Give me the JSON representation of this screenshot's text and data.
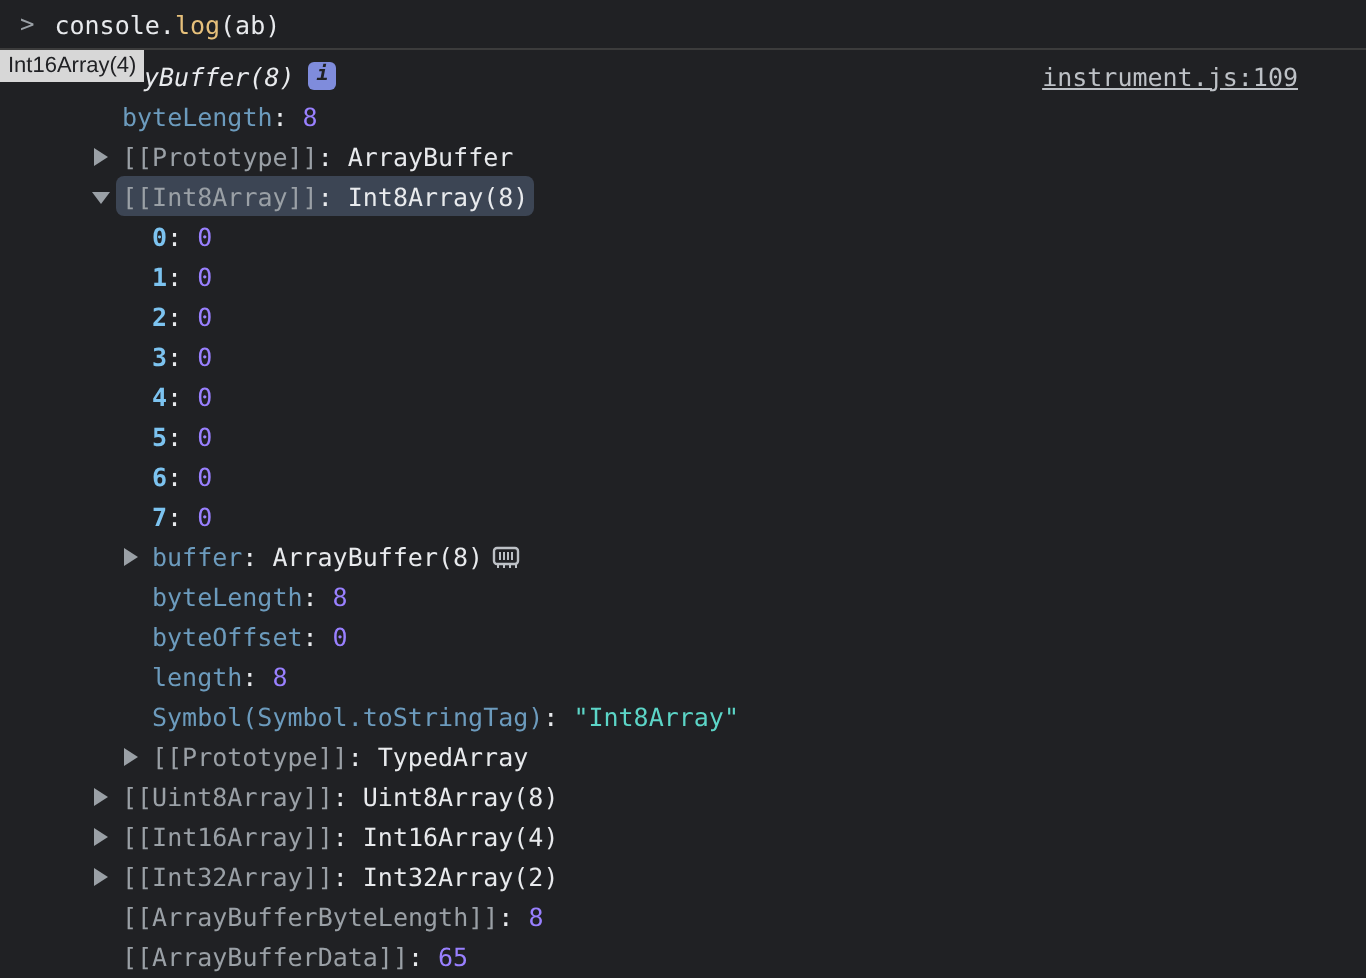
{
  "input": {
    "prompt": ">",
    "code_parts": [
      {
        "text": "console.",
        "kind": "plain"
      },
      {
        "text": "log",
        "kind": "function"
      },
      {
        "text": "(ab)",
        "kind": "plain"
      }
    ]
  },
  "tooltip": "Int16Array(4)",
  "header": {
    "text": "yBuffer(8)",
    "badge": "i",
    "source": "instrument.js:109"
  },
  "tree": [
    {
      "key": {
        "text": "byteLength",
        "kind": "prop"
      },
      "sep": ":",
      "value": {
        "text": "8",
        "kind": "number"
      },
      "selected": false
    },
    {
      "key": {
        "text": "[[Prototype]]",
        "kind": "internal"
      },
      "sep": ":",
      "value": {
        "text": "ArrayBuffer",
        "kind": "object"
      },
      "expanded": false,
      "selected": false
    },
    {
      "key": {
        "text": "[[Int8Array]]",
        "kind": "internal"
      },
      "sep": ":",
      "value": {
        "text": "Int8Array(8)",
        "kind": "object"
      },
      "expanded": true,
      "selected": true,
      "children": [
        {
          "key": {
            "text": "0",
            "kind": "index"
          },
          "sep": ":",
          "value": {
            "text": "0",
            "kind": "number"
          },
          "selected": false
        },
        {
          "key": {
            "text": "1",
            "kind": "index"
          },
          "sep": ":",
          "value": {
            "text": "0",
            "kind": "number"
          },
          "selected": false
        },
        {
          "key": {
            "text": "2",
            "kind": "index"
          },
          "sep": ":",
          "value": {
            "text": "0",
            "kind": "number"
          },
          "selected": false
        },
        {
          "key": {
            "text": "3",
            "kind": "index"
          },
          "sep": ":",
          "value": {
            "text": "0",
            "kind": "number"
          },
          "selected": false
        },
        {
          "key": {
            "text": "4",
            "kind": "index"
          },
          "sep": ":",
          "value": {
            "text": "0",
            "kind": "number"
          },
          "selected": false
        },
        {
          "key": {
            "text": "5",
            "kind": "index"
          },
          "sep": ":",
          "value": {
            "text": "0",
            "kind": "number"
          },
          "selected": false
        },
        {
          "key": {
            "text": "6",
            "kind": "index"
          },
          "sep": ":",
          "value": {
            "text": "0",
            "kind": "number"
          },
          "selected": false
        },
        {
          "key": {
            "text": "7",
            "kind": "index"
          },
          "sep": ":",
          "value": {
            "text": "0",
            "kind": "number"
          },
          "selected": false
        },
        {
          "key": {
            "text": "buffer",
            "kind": "prop"
          },
          "sep": ":",
          "value": {
            "text": "ArrayBuffer(8)",
            "kind": "object"
          },
          "expanded": false,
          "memory_button": true,
          "selected": false
        },
        {
          "key": {
            "text": "byteLength",
            "kind": "prop"
          },
          "sep": ":",
          "value": {
            "text": "8",
            "kind": "number"
          },
          "selected": false
        },
        {
          "key": {
            "text": "byteOffset",
            "kind": "prop"
          },
          "sep": ":",
          "value": {
            "text": "0",
            "kind": "number"
          },
          "selected": false
        },
        {
          "key": {
            "text": "length",
            "kind": "prop"
          },
          "sep": ":",
          "value": {
            "text": "8",
            "kind": "number"
          },
          "selected": false
        },
        {
          "key": {
            "text": "Symbol(Symbol.toStringTag)",
            "kind": "prop"
          },
          "sep": ":",
          "value": {
            "text": "\"Int8Array\"",
            "kind": "string"
          },
          "selected": false
        },
        {
          "key": {
            "text": "[[Prototype]]",
            "kind": "internal"
          },
          "sep": ":",
          "value": {
            "text": "TypedArray",
            "kind": "object"
          },
          "expanded": false,
          "selected": false
        }
      ]
    },
    {
      "key": {
        "text": "[[Uint8Array]]",
        "kind": "internal"
      },
      "sep": ":",
      "value": {
        "text": "Uint8Array(8)",
        "kind": "object"
      },
      "expanded": false,
      "selected": false
    },
    {
      "key": {
        "text": "[[Int16Array]]",
        "kind": "internal"
      },
      "sep": ":",
      "value": {
        "text": "Int16Array(4)",
        "kind": "object"
      },
      "expanded": false,
      "selected": false
    },
    {
      "key": {
        "text": "[[Int32Array]]",
        "kind": "internal"
      },
      "sep": ":",
      "value": {
        "text": "Int32Array(2)",
        "kind": "object"
      },
      "expanded": false,
      "selected": false
    },
    {
      "key": {
        "text": "[[ArrayBufferByteLength]]",
        "kind": "internal"
      },
      "sep": ":",
      "value": {
        "text": "8",
        "kind": "number"
      },
      "selected": false
    },
    {
      "key": {
        "text": "[[ArrayBufferData]]",
        "kind": "internal"
      },
      "sep": ":",
      "value": {
        "text": "65",
        "kind": "number"
      },
      "selected": false
    }
  ]
}
